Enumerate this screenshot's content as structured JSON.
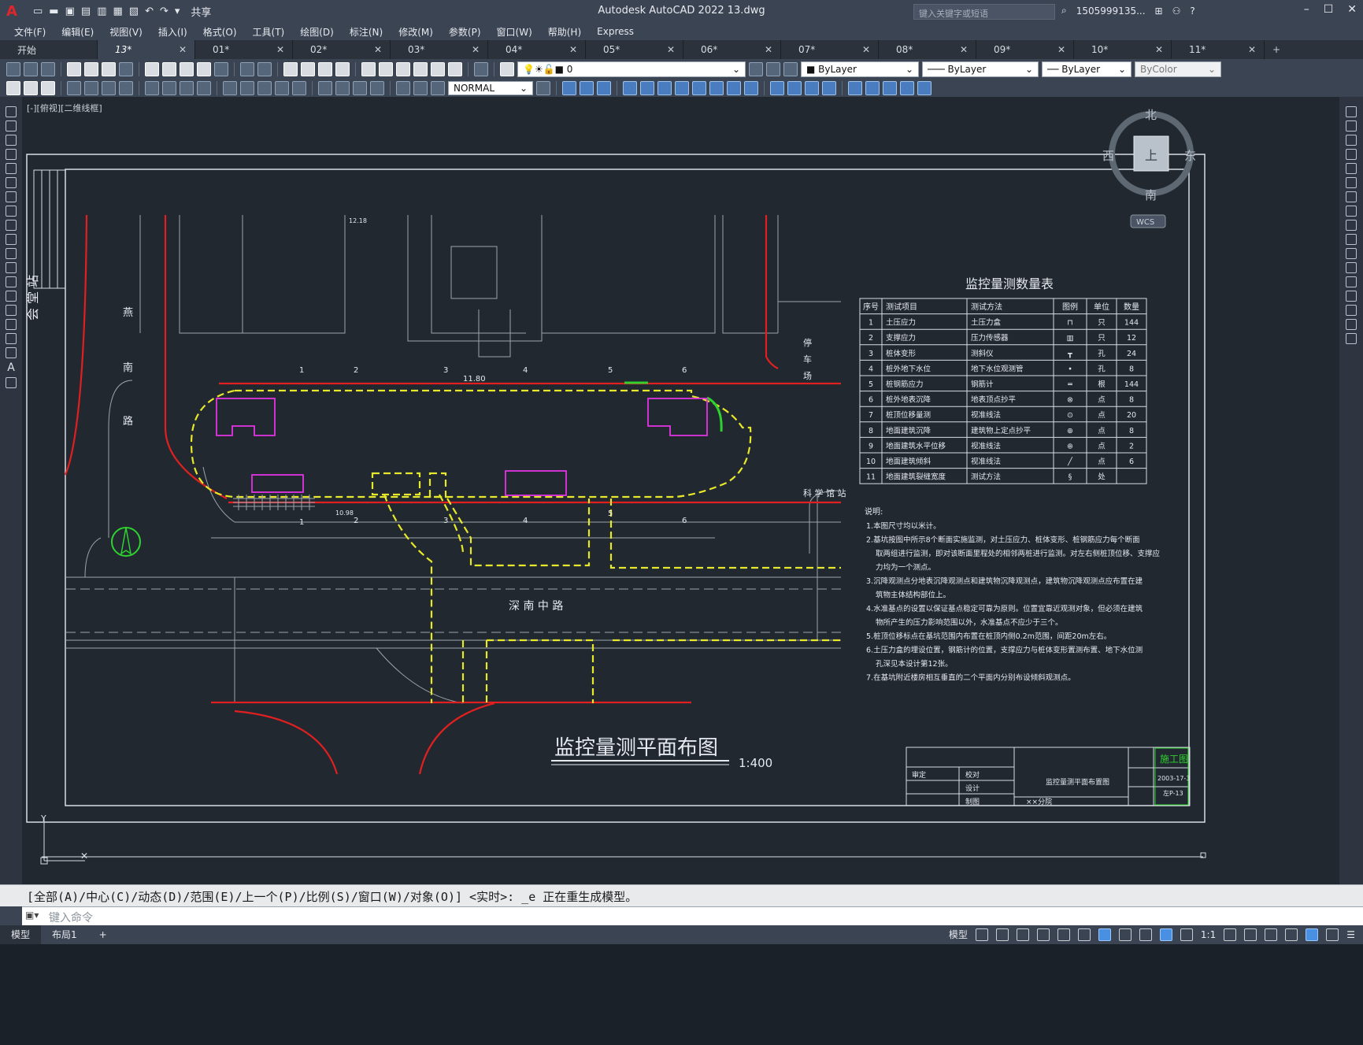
{
  "app": {
    "title": "Autodesk AutoCAD 2022    13.dwg",
    "logo": "A",
    "share_label": "共享"
  },
  "search": {
    "placeholder": "键入关键字或短语"
  },
  "user": {
    "name": "1505999135..."
  },
  "menu": [
    "文件(F)",
    "编辑(E)",
    "视图(V)",
    "插入(I)",
    "格式(O)",
    "工具(T)",
    "绘图(D)",
    "标注(N)",
    "修改(M)",
    "参数(P)",
    "窗口(W)",
    "帮助(H)",
    "Express"
  ],
  "tabs": [
    {
      "label": "开始",
      "active": false,
      "closable": false
    },
    {
      "label": "13*",
      "active": true,
      "closable": true
    },
    {
      "label": "01*",
      "active": false,
      "closable": true
    },
    {
      "label": "02*",
      "active": false,
      "closable": true
    },
    {
      "label": "03*",
      "active": false,
      "closable": true
    },
    {
      "label": "04*",
      "active": false,
      "closable": true
    },
    {
      "label": "05*",
      "active": false,
      "closable": true
    },
    {
      "label": "06*",
      "active": false,
      "closable": true
    },
    {
      "label": "07*",
      "active": false,
      "closable": true
    },
    {
      "label": "08*",
      "active": false,
      "closable": true
    },
    {
      "label": "09*",
      "active": false,
      "closable": true
    },
    {
      "label": "10*",
      "active": false,
      "closable": true
    },
    {
      "label": "11*",
      "active": false,
      "closable": true
    }
  ],
  "toolbar": {
    "layer_value": "0",
    "color": "ByLayer",
    "linetype": "ByLayer",
    "lineweight": "ByLayer",
    "plotstyle": "ByColor",
    "dimstyle": "NORMAL"
  },
  "view": {
    "label": "[-][俯视][二维线框]"
  },
  "viewcube": {
    "n": "北",
    "s": "南",
    "e": "东",
    "w": "西",
    "face": "上",
    "wcs": "WCS"
  },
  "drawing": {
    "title": "监控量测平面布图",
    "scale": "1:400",
    "roads": {
      "left": [
        "燕",
        "南",
        "路"
      ],
      "center": "深 南 中 路",
      "right": "科 学 馆 站",
      "left_edge": "会 堂 站",
      "parking": [
        "停",
        "车",
        "场"
      ]
    },
    "section_nums": [
      "1",
      "2",
      "3",
      "4",
      "5",
      "6"
    ],
    "elev_labels": [
      "11.80",
      "10.98",
      "12.18"
    ],
    "table": {
      "title": "监控量测数量表",
      "headers": [
        "序号",
        "测试项目",
        "测试方法",
        "图例",
        "单位",
        "数量"
      ],
      "rows": [
        [
          "1",
          "土压应力",
          "土压力盒",
          "⊓",
          "只",
          "144"
        ],
        [
          "2",
          "支撑应力",
          "压力传感器",
          "▥",
          "只",
          "12"
        ],
        [
          "3",
          "桩体变形",
          "测斜仪",
          "┳",
          "孔",
          "24"
        ],
        [
          "4",
          "桩外地下水位",
          "地下水位观测管",
          "•",
          "孔",
          "8"
        ],
        [
          "5",
          "桩钢筋应力",
          "钢筋计",
          "═",
          "根",
          "144"
        ],
        [
          "6",
          "桩外地表沉降",
          "地表顶点抄平",
          "⊗",
          "点",
          "8"
        ],
        [
          "7",
          "桩顶位移量测",
          "视准线法",
          "⊙",
          "点",
          "20"
        ],
        [
          "8",
          "地面建筑沉降",
          "建筑物上定点抄平",
          "⊕",
          "点",
          "8"
        ],
        [
          "9",
          "地面建筑水平位移",
          "视准线法",
          "⊕",
          "点",
          "2"
        ],
        [
          "10",
          "地面建筑倾斜",
          "视准线法",
          "╱",
          "点",
          "6"
        ],
        [
          "11",
          "地面建筑裂缝宽度",
          "测试方法",
          "§",
          "处",
          ""
        ]
      ]
    },
    "notes": {
      "title": "说明:",
      "items": [
        "1.本图尺寸均以米计。",
        "2.基坑按图中所示8个断面实施监测，对土压应力、桩体变形、桩钢筋应力每个断面取两组进行监测，即对该断面里程处的相邻两桩进行监测。对左右侧桩顶位移、支撑应力均为一个测点。",
        "3.沉降观测点分地表沉降观测点和建筑物沉降观测点，建筑物沉降观测点应布置在建筑物主体结构部位上。",
        "4.水准基点的设置以保证基点稳定可靠为原则。位置宜靠近观测对象，但必须在建筑物所产生的压力影响范围以外，水准基点不应少于三个。",
        "5.桩顶位移标点在基坑范围内布置在桩顶内侧0.2m范围，间距20m左右。",
        "6.土压力盒的埋设位置，钢筋计的位置，支撑应力与桩体变形置测布置、地下水位测孔深见本设计第12张。",
        "7.在基坑附近楼房相互垂直的二个平面内分别布设倾斜观测点。"
      ]
    },
    "titleblock": {
      "stamp": "施工图",
      "name": "监控量测平面布置图",
      "date": "2003-17-3",
      "code": "左P-13",
      "company": "××分院",
      "roles": [
        "审定",
        "校对",
        "设计",
        "制图"
      ]
    }
  },
  "command": {
    "history": "[全部(A)/中心(C)/动态(D)/范围(E)/上一个(P)/比例(S)/窗口(W)/对象(O)] <实时>: _e 正在重生成模型。",
    "placeholder": "键入命令"
  },
  "status": {
    "tabs": [
      "模型",
      "布局1"
    ],
    "model_label": "模型",
    "scale": "1:1"
  }
}
